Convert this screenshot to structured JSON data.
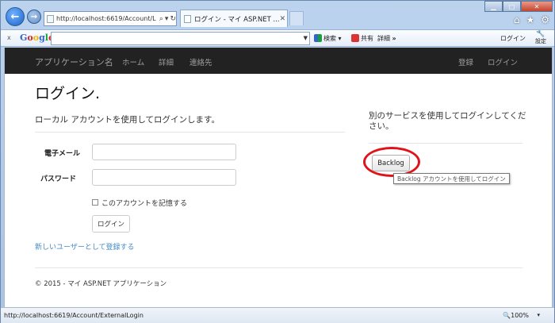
{
  "browser": {
    "address_url": "http://localhost:6619/Account/L",
    "tab_title": "ログイン - マイ ASP.NET ...",
    "status_url": "http://localhost:6619/Account/ExternalLogin",
    "zoom": "100%"
  },
  "google_toolbar": {
    "close": "x",
    "logo": "Google",
    "search_value": "",
    "search_label": "検索",
    "share_label": "共有",
    "details_label": "詳細",
    "more": "»",
    "login_label": "ログイン",
    "settings_label": "設定"
  },
  "app_nav": {
    "brand": "アプリケーション名",
    "links": [
      "ホーム",
      "詳細",
      "連絡先"
    ],
    "register": "登録",
    "login": "ログイン"
  },
  "page": {
    "title": "ログイン.",
    "local_heading": "ローカル アカウントを使用してログインします。",
    "email_label": "電子メール",
    "password_label": "パスワード",
    "email_value": "",
    "password_value": "",
    "remember_label": "このアカウントを記憶する",
    "login_button": "ログイン",
    "register_link": "新しいユーザーとして登録する",
    "external_heading": "別のサービスを使用してログインしてください。",
    "backlog_button": "Backlog",
    "backlog_tooltip": "Backlog アカウントを使用してログイン",
    "footer": "© 2015 - マイ ASP.NET アプリケーション"
  },
  "colors": {
    "navbar": "#222222",
    "link": "#428bca",
    "highlight_circle": "#e0131a"
  }
}
